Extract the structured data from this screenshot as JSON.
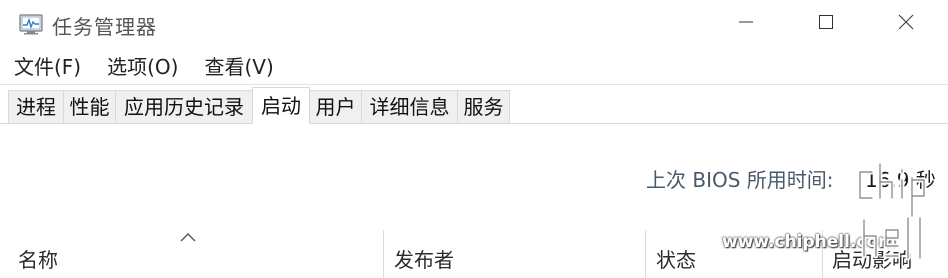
{
  "window": {
    "title": "任务管理器",
    "app_icon": "task-manager-icon",
    "controls": {
      "minimize_icon": "minimize-icon",
      "maximize_icon": "maximize-icon",
      "close_icon": "close-icon"
    }
  },
  "menu": {
    "items": [
      {
        "label": "文件(F)"
      },
      {
        "label": "选项(O)"
      },
      {
        "label": "查看(V)"
      }
    ]
  },
  "tabs": [
    {
      "label": "进程"
    },
    {
      "label": "性能"
    },
    {
      "label": "应用历史记录"
    },
    {
      "label": "启动",
      "active": true
    },
    {
      "label": "用户"
    },
    {
      "label": "详细信息"
    },
    {
      "label": "服务"
    }
  ],
  "startup": {
    "bios_label": "上次 BIOS 所用时间:",
    "bios_value": "16.9 秒"
  },
  "columns": [
    {
      "label": "名称",
      "sorted": true
    },
    {
      "label": "发布者"
    },
    {
      "label": "状态"
    },
    {
      "label": "启动影响"
    }
  ],
  "watermark": {
    "text": "www.chiphell.com",
    "logo_text": "chiphell"
  },
  "colors": {
    "tab_inactive_bg": "#f0f0f0",
    "tab_active_bg": "#ffffff",
    "label_muted": "#4a5a6a"
  }
}
